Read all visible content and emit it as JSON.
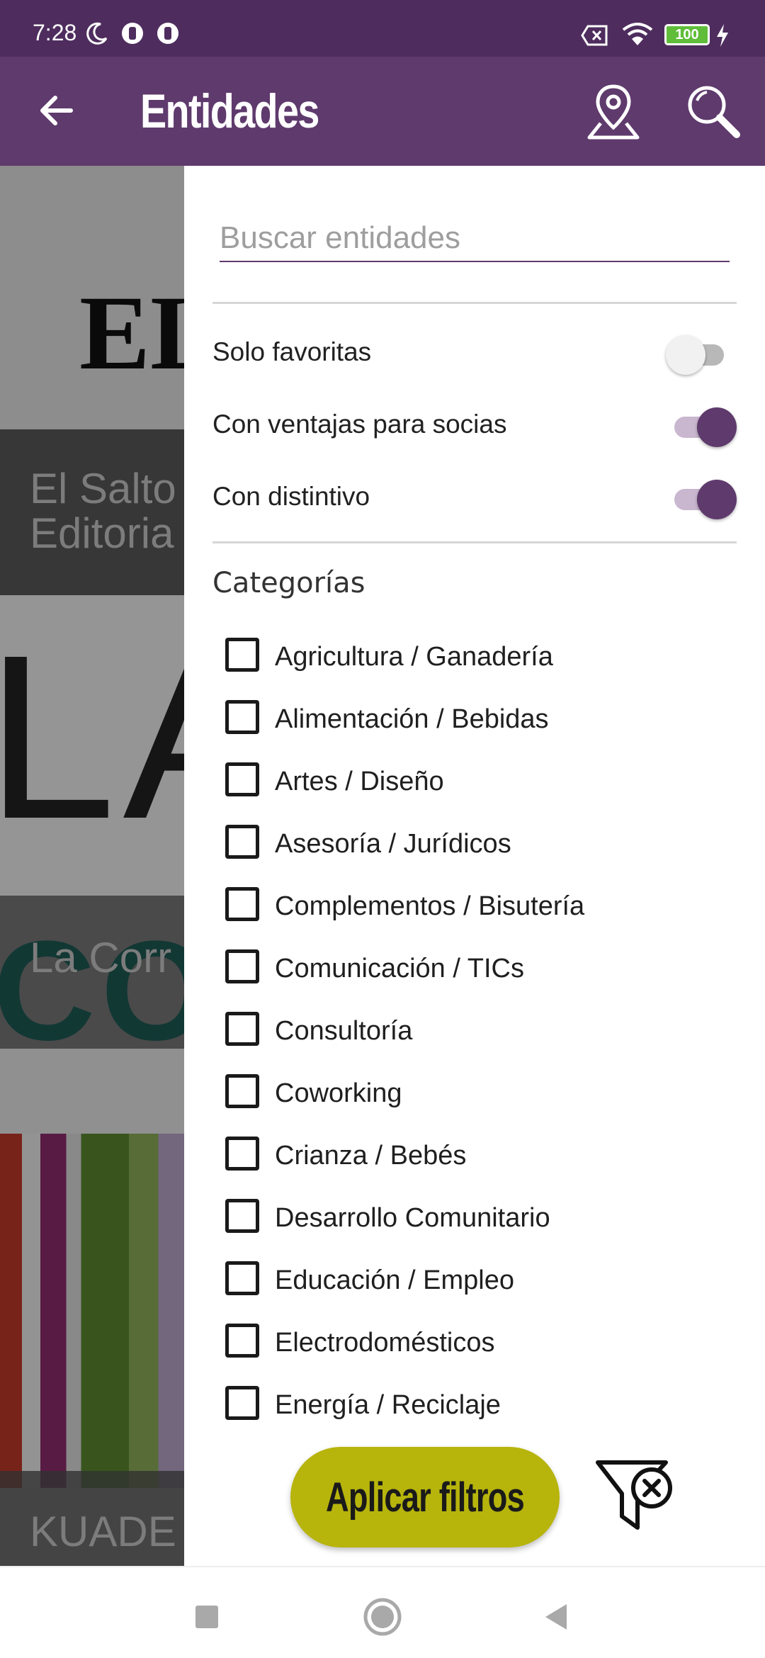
{
  "status_bar": {
    "time": "7:28",
    "battery": "100",
    "icons": [
      "moon-icon",
      "notification-icon",
      "notification-icon",
      "screen-record-icon",
      "wifi-icon",
      "battery-icon",
      "charging-icon"
    ]
  },
  "app_bar": {
    "title": "Entidades",
    "back_icon": "arrow-left-icon",
    "map_icon": "map-pin-icon",
    "search_icon": "search-icon"
  },
  "background_list": {
    "cards": [
      {
        "label": "El Salto\nEditoria"
      },
      {
        "label": "La Corr"
      },
      {
        "label": "KUADE"
      }
    ],
    "image_texts": [
      "EL",
      "LA",
      "COOP"
    ]
  },
  "drawer": {
    "search": {
      "placeholder": "Buscar entidades",
      "value": ""
    },
    "toggles": [
      {
        "label": "Solo favoritas",
        "on": false
      },
      {
        "label": "Con ventajas para socias",
        "on": true
      },
      {
        "label": "Con distintivo",
        "on": true
      }
    ],
    "categories_title": "Categorías",
    "categories": [
      {
        "label": "Agricultura / Ganadería",
        "checked": false
      },
      {
        "label": "Alimentación / Bebidas",
        "checked": false
      },
      {
        "label": "Artes / Diseño",
        "checked": false
      },
      {
        "label": "Asesoría / Jurídicos",
        "checked": false
      },
      {
        "label": "Complementos / Bisutería",
        "checked": false
      },
      {
        "label": "Comunicación / TICs",
        "checked": false
      },
      {
        "label": "Consultoría",
        "checked": false
      },
      {
        "label": "Coworking",
        "checked": false
      },
      {
        "label": "Crianza / Bebés",
        "checked": false
      },
      {
        "label": "Desarrollo Comunitario",
        "checked": false
      },
      {
        "label": "Educación / Empleo",
        "checked": false
      },
      {
        "label": "Electrodomésticos",
        "checked": false
      },
      {
        "label": "Energía / Reciclaje",
        "checked": false
      }
    ],
    "apply_label": "Aplicar filtros",
    "clear_filter_icon": "filter-clear-icon"
  },
  "colors": {
    "primary": "#5f3a6d",
    "status_bar": "#4e2d5e",
    "accent": "#b7b40c"
  },
  "nav_bar": {
    "icons": [
      "recents-square-icon",
      "home-circle-icon",
      "back-triangle-icon"
    ]
  }
}
